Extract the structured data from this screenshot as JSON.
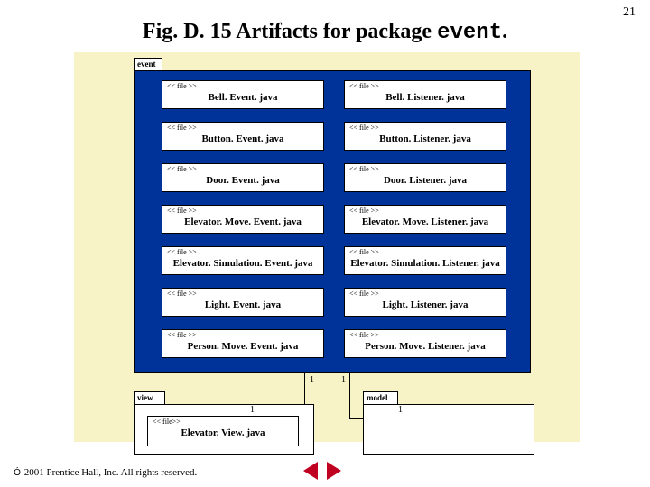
{
  "page_number": "21",
  "title_prefix": "Fig. D. 15   Artifacts for package ",
  "title_pkg": "event",
  "title_suffix": ".",
  "stereo": "<< file >>",
  "stereo2": "<< file>>",
  "packages": {
    "event": {
      "label": "event"
    },
    "view": {
      "label": "view"
    },
    "model": {
      "label": "model"
    }
  },
  "artifacts_left": [
    "Bell. Event. java",
    "Button. Event. java",
    "Door. Event. java",
    "Elevator. Move. Event. java",
    "Elevator. Simulation. Event. java",
    "Light. Event. java",
    "Person. Move. Event. java"
  ],
  "artifacts_right": [
    "Bell. Listener. java",
    "Button. Listener. java",
    "Door. Listener. java",
    "Elevator. Move. Listener. java",
    "Elevator. Simulation. Listener. java",
    "Light. Listener. java",
    "Person. Move. Listener. java"
  ],
  "view_artifact": "Elevator. View. java",
  "mult": {
    "ev_left": "1",
    "ev_right": "1",
    "view": "1",
    "model": "1"
  },
  "footer": " 2001 Prentice Hall, Inc. All rights reserved.",
  "copyright_symbol": "Ó"
}
